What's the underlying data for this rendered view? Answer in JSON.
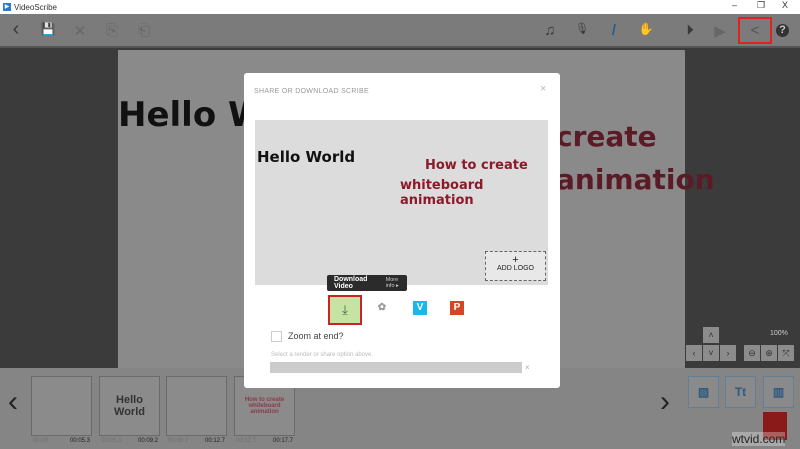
{
  "window": {
    "title": "VideoScribe",
    "minimize": "–",
    "maximize": "❐",
    "close": "X"
  },
  "toolbar": {
    "back": "‹",
    "save": "💾",
    "cut": "✕",
    "copy": "⎘",
    "paste": "⎗",
    "music": "♫",
    "mic": "🎙",
    "pen": "/",
    "hand": "✋",
    "play_from": "⏵",
    "play": "▶",
    "share": "<",
    "help": "?"
  },
  "canvas": {
    "text_hello": "Hello Wor",
    "text_create": "create",
    "text_animation": "animation",
    "zoom_level": "100%"
  },
  "modal": {
    "title": "SHARE OR DOWNLOAD SCRIBE",
    "close": "×",
    "preview": {
      "hello": "Hello World",
      "heading_line1": "How to create",
      "heading_line2": "whiteboard animation",
      "add_logo_plus": "+",
      "add_logo": "ADD LOGO"
    },
    "tooltip": {
      "label": "Download Video",
      "more": "More info ▸"
    },
    "options": [
      {
        "name": "download",
        "glyph": "⤓"
      },
      {
        "name": "youtube",
        "glyph": "✿"
      },
      {
        "name": "vimeo",
        "glyph": "V",
        "color": "#1ab7ea"
      },
      {
        "name": "powerpoint",
        "glyph": "P",
        "color": "#d24726"
      }
    ],
    "zoom_label": "Zoom at end?",
    "hint": "Select a render or share option above.",
    "clear": "×"
  },
  "timeline": {
    "prev": "‹",
    "next": "›",
    "thumbs": [
      {
        "label": "",
        "start": "00:00",
        "end": "00:05.3"
      },
      {
        "label": "Hello World",
        "start": "00:05.3",
        "end": "00:09.2"
      },
      {
        "label": "",
        "start": "00:09.2",
        "end": "00:12.7"
      },
      {
        "label": "How to create whiteboard animation",
        "start": "00:12.7",
        "end": "00:17.7"
      }
    ],
    "add_image": "▧",
    "add_text": "Tt",
    "add_chart": "▥"
  },
  "watermark": "wtvid.com",
  "colors": {
    "accent": "#d22222",
    "download_bg": "#c5e4a3",
    "heading": "#8b1a2b"
  }
}
